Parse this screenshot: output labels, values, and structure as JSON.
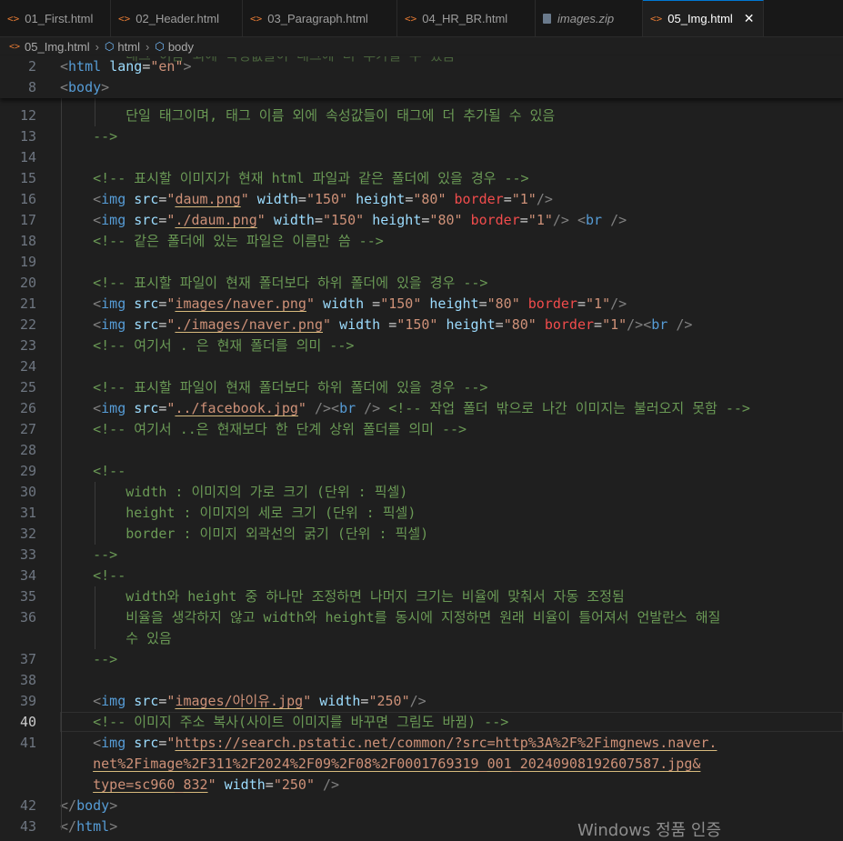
{
  "tabs": [
    {
      "label": "01_First.html",
      "icon": "html-icon"
    },
    {
      "label": "02_Header.html",
      "icon": "html-icon"
    },
    {
      "label": "03_Paragraph.html",
      "icon": "html-icon"
    },
    {
      "label": "04_HR_BR.html",
      "icon": "html-icon"
    },
    {
      "label": "images.zip",
      "icon": "zip-icon"
    },
    {
      "label": "05_Img.html",
      "icon": "html-icon",
      "close": "✕"
    }
  ],
  "breadcrumb": {
    "file": "05_Img.html",
    "item1": "html",
    "item2": "body"
  },
  "sticky": [
    {
      "num": "2",
      "code": "<html lang=\"en\">"
    },
    {
      "num": "8",
      "code": "<body>"
    }
  ],
  "lines": [
    {
      "num": "12",
      "text": "        단일 태그이며, 태그 이름 외에 속성값들이 태그에 더 추가될 수 있음"
    },
    {
      "num": "13",
      "text": "    -->"
    },
    {
      "num": "14",
      "text": ""
    },
    {
      "num": "15",
      "text": "    <!-- 표시할 이미지가 현재 html 파일과 같은 폴더에 있을 경우 -->"
    },
    {
      "num": "16",
      "text": "    <img src=\"daum.png\" width=\"150\" height=\"80\" border=\"1\"/>"
    },
    {
      "num": "17",
      "text": "    <img src=\"./daum.png\" width=\"150\" height=\"80\" border=\"1\"/> <br />"
    },
    {
      "num": "18",
      "text": "    <!-- 같은 폴더에 있는 파일은 이름만 씀 -->"
    },
    {
      "num": "19",
      "text": ""
    },
    {
      "num": "20",
      "text": "    <!-- 표시할 파일이 현재 폴더보다 하위 폴더에 있을 경우 -->"
    },
    {
      "num": "21",
      "text": "    <img src=\"images/naver.png\" width =\"150\" height=\"80\" border=\"1\"/>"
    },
    {
      "num": "22",
      "text": "    <img src=\"./images/naver.png\" width =\"150\" height=\"80\" border=\"1\"/><br />"
    },
    {
      "num": "23",
      "text": "    <!-- 여기서 . 은 현재 폴더를 의미 -->"
    },
    {
      "num": "24",
      "text": ""
    },
    {
      "num": "25",
      "text": "    <!-- 표시할 파일이 현재 폴더보다 하위 폴더에 있을 경우 -->"
    },
    {
      "num": "26",
      "text": "    <img src=\"../facebook.jpg\" /><br /> <!-- 작업 폴더 밖으로 나간 이미지는 불러오지 못함 -->"
    },
    {
      "num": "27",
      "text": "    <!-- 여기서 ..은 현재보다 한 단계 상위 폴더를 의미 -->"
    },
    {
      "num": "28",
      "text": ""
    },
    {
      "num": "29",
      "text": "    <!--"
    },
    {
      "num": "30",
      "text": "        width : 이미지의 가로 크기 (단위 : 픽셀)"
    },
    {
      "num": "31",
      "text": "        height : 이미지의 세로 크기 (단위 : 픽셀)"
    },
    {
      "num": "32",
      "text": "        border : 이미지 외곽선의 굵기 (단위 : 픽셀)"
    },
    {
      "num": "33",
      "text": "    -->"
    },
    {
      "num": "34",
      "text": "    <!--"
    },
    {
      "num": "35",
      "text": "        width와 height 중 하나만 조정하면 나머지 크기는 비율에 맞춰서 자동 조정됨"
    },
    {
      "num": "36",
      "text": "        비율을 생각하지 않고 width와 height를 동시에 지정하면 원래 비율이 틀어져서 언발란스 해질"
    },
    {
      "num": "",
      "text": "        수 있음"
    },
    {
      "num": "37",
      "text": "    -->"
    },
    {
      "num": "38",
      "text": ""
    },
    {
      "num": "39",
      "text": "    <img src=\"images/아이유.jpg\" width=\"250\"/>"
    },
    {
      "num": "40",
      "text": "    <!-- 이미지 주소 복사(사이트 이미지를 바꾸면 그림도 바뀜) -->"
    },
    {
      "num": "41",
      "text": "    <img src=\"https://search.pstatic.net/common/?src=http%3A%2F%2Fimgnews.naver."
    },
    {
      "num": "",
      "text": "    net%2Fimage%2F311%2F2024%2F09%2F08%2F0001769319_001_20240908192607587.jpg&"
    },
    {
      "num": "",
      "text": "    type=sc960_832\" width=\"250\" />"
    },
    {
      "num": "42",
      "text": "</body>"
    },
    {
      "num": "43",
      "text": "</html>"
    }
  ],
  "current_line": "40",
  "watermark": "Windows 정품 인증"
}
